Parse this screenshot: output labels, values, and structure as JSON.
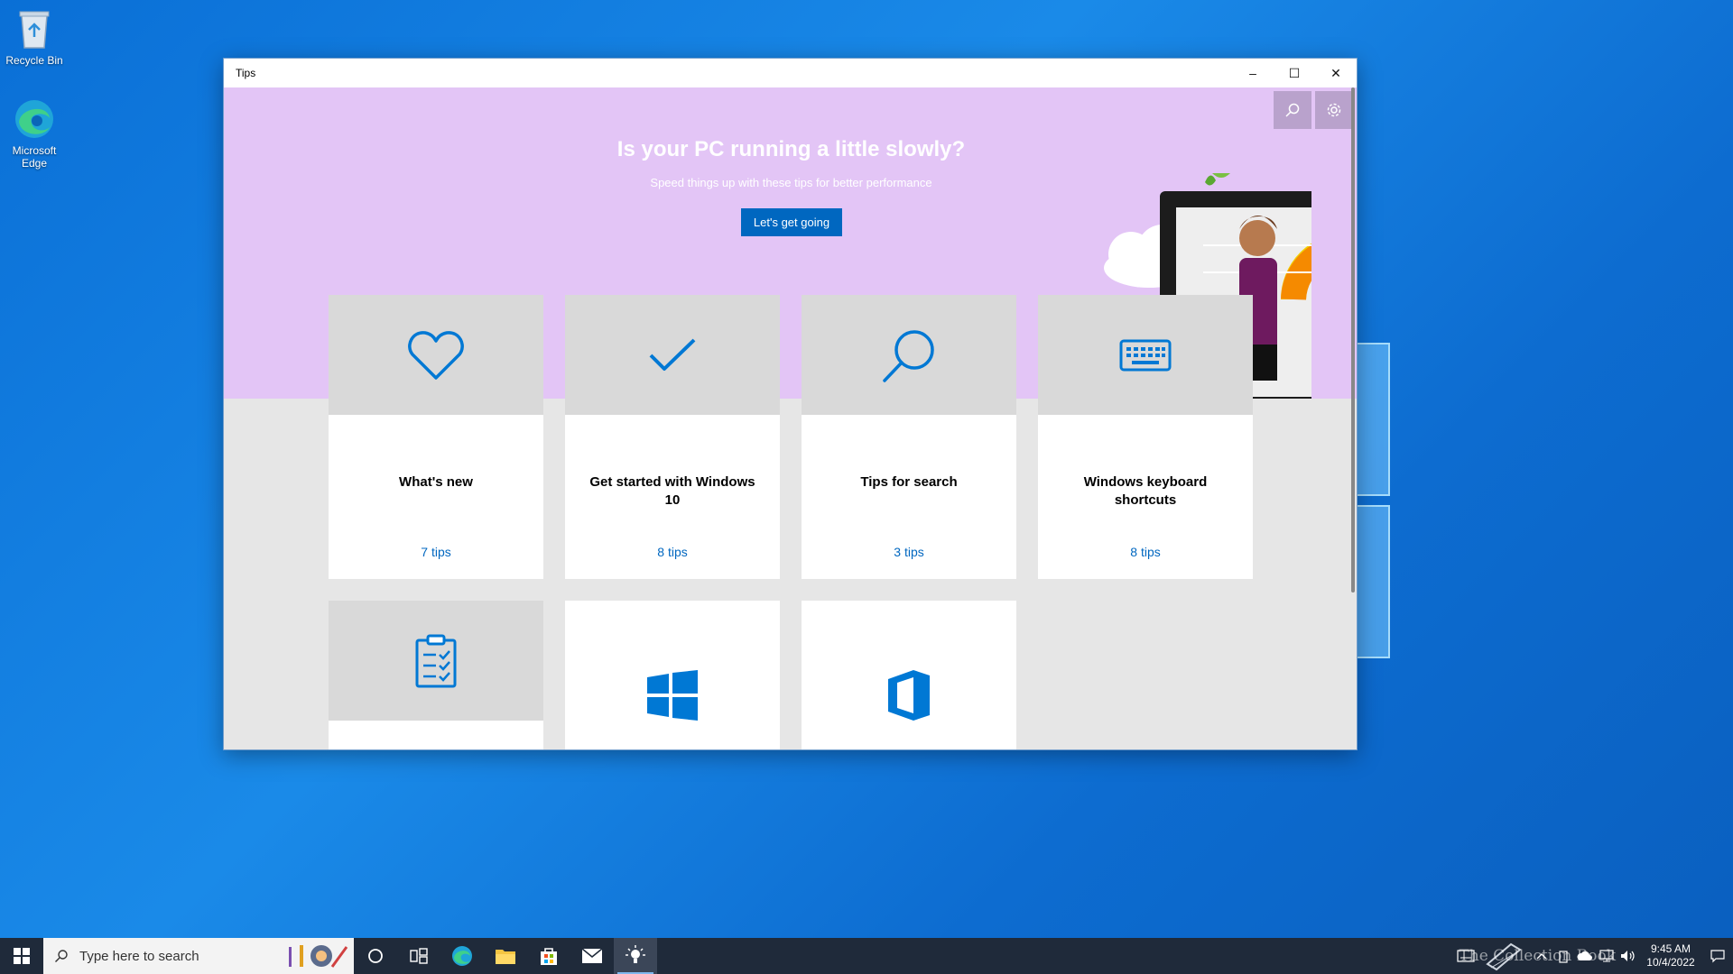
{
  "desktop": {
    "icons": [
      {
        "label": "Recycle Bin"
      },
      {
        "label": "Microsoft Edge"
      }
    ]
  },
  "window": {
    "title": "Tips",
    "controls": {
      "minimize": "–",
      "maximize": "☐",
      "close": "✕"
    }
  },
  "hero": {
    "title": "Is your PC running a little slowly?",
    "subtitle": "Speed things up with these tips for better performance",
    "button_label": "Let's get going"
  },
  "cards": [
    {
      "name": "What's new",
      "count": "7 tips",
      "icon": "heart-icon"
    },
    {
      "name": "Get started with Windows 10",
      "count": "8 tips",
      "icon": "checkmark-icon"
    },
    {
      "name": "Tips for search",
      "count": "3 tips",
      "icon": "magnifier-icon"
    },
    {
      "name": "Windows keyboard shortcuts",
      "count": "8 tips",
      "icon": "keyboard-icon"
    },
    {
      "name": "",
      "count": "",
      "icon": "clipboard-checklist-icon"
    },
    {
      "name": "",
      "count": "",
      "icon": "windows-logo-icon"
    },
    {
      "name": "",
      "count": "",
      "icon": "office-logo-icon"
    }
  ],
  "taskbar": {
    "search_placeholder": "Type here to search",
    "clock_time": "9:45 AM",
    "clock_date": "10/4/2022",
    "watermark": "The Collection Book"
  },
  "colors": {
    "hero_bg": "#e3c5f6",
    "accent": "#0067c0",
    "icon_blue": "#0078d4",
    "taskbar_bg": "#1f2a3a"
  }
}
